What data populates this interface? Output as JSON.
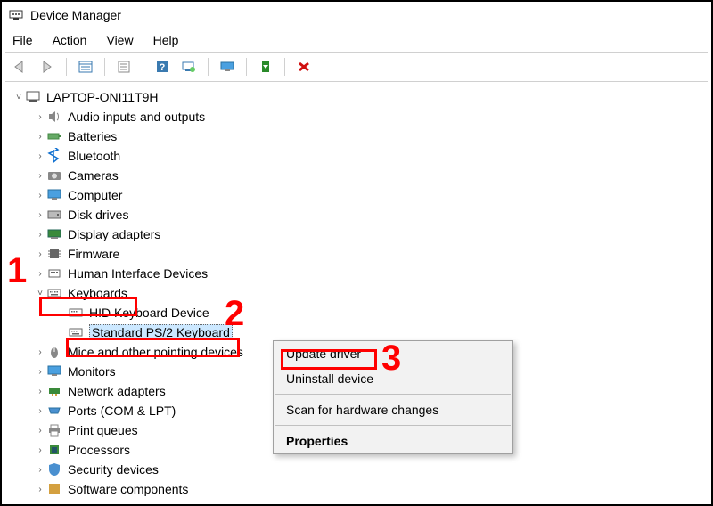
{
  "window": {
    "title": "Device Manager"
  },
  "menu": {
    "file": "File",
    "action": "Action",
    "view": "View",
    "help": "Help"
  },
  "toolbar_icons": [
    "back",
    "forward",
    "list",
    "properties",
    "help",
    "monitor-help",
    "monitor",
    "install",
    "delete"
  ],
  "root": {
    "label": "LAPTOP-ONI11T9H"
  },
  "categories": {
    "audio": "Audio inputs and outputs",
    "batteries": "Batteries",
    "bluetooth": "Bluetooth",
    "cameras": "Cameras",
    "computer": "Computer",
    "disk": "Disk drives",
    "display": "Display adapters",
    "firmware": "Firmware",
    "hid": "Human Interface Devices",
    "keyboards": "Keyboards",
    "kb_hid": "HID Keyboard Device",
    "kb_ps2": "Standard PS/2 Keyboard",
    "mice": "Mice and other pointing devices",
    "monitors": "Monitors",
    "network": "Network adapters",
    "ports": "Ports (COM & LPT)",
    "printq": "Print queues",
    "processors": "Processors",
    "security": "Security devices",
    "software": "Software components"
  },
  "context_menu": {
    "update": "Update driver",
    "uninstall": "Uninstall device",
    "scan": "Scan for hardware changes",
    "properties": "Properties"
  },
  "annotations": {
    "n1": "1",
    "n2": "2",
    "n3": "3"
  }
}
